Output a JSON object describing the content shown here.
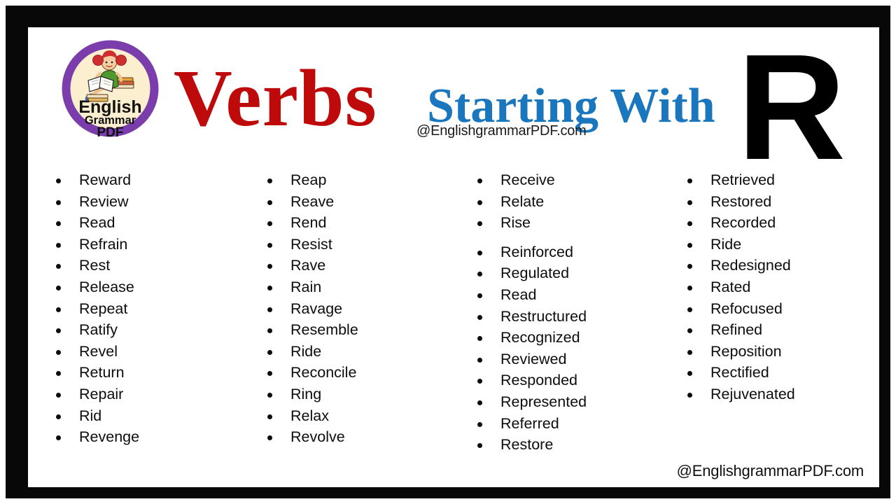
{
  "colors": {
    "frame": "#080808",
    "background": "#ffffff",
    "verbs_red": "#be0a0a",
    "starting_with_blue": "#1a76bd",
    "letter_black": "#000000",
    "logo_ring_purple": "#7a3dab",
    "logo_inner_cream": "#fbefd0",
    "text_black": "#0d0d0d"
  },
  "logo": {
    "name": "english-grammar-pdf-logo",
    "line1": "English",
    "line2": "Grammar",
    "line3": "PDF",
    "illustration": "girl-reading-book-on-stack-of-books"
  },
  "header": {
    "title_word_1": "Verbs",
    "title_word_2": "Starting With",
    "title_letter": "R",
    "watermark": "@EnglishgrammarPDF.com"
  },
  "footer": {
    "watermark": "@EnglishgrammarPDF.com"
  },
  "columns": [
    {
      "id": "column-1",
      "groups": [
        {
          "items": [
            "Reward",
            "Review",
            "Read",
            "Refrain",
            "Rest",
            "Release",
            "Repeat",
            "Ratify",
            "Revel",
            "Return",
            "Repair",
            "Rid",
            "Revenge"
          ]
        }
      ]
    },
    {
      "id": "column-2",
      "groups": [
        {
          "items": [
            "Reap",
            "Reave",
            "Rend",
            "Resist",
            "Rave",
            "Rain",
            "Ravage",
            "Resemble",
            "Ride",
            "Reconcile",
            "Ring",
            "Relax",
            "Revolve"
          ]
        }
      ]
    },
    {
      "id": "column-3",
      "groups": [
        {
          "items": [
            "Receive",
            "Relate",
            "Rise"
          ]
        },
        {
          "items": [
            "Reinforced",
            "Regulated",
            "Read",
            "Restructured",
            "Recognized",
            "Reviewed",
            "Responded",
            "Represented",
            "Referred",
            "Restore"
          ]
        }
      ]
    },
    {
      "id": "column-4",
      "groups": [
        {
          "items": [
            "Retrieved",
            "Restored",
            "Recorded",
            "Ride",
            "Redesigned",
            "Rated",
            "Refocused",
            "Refined",
            "Reposition",
            "Rectified",
            "Rejuvenated"
          ]
        }
      ]
    }
  ]
}
